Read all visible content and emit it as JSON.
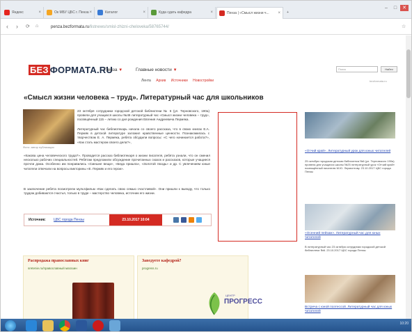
{
  "browser": {
    "tabs": [
      {
        "label": "Яндекс",
        "color": "#e52620"
      },
      {
        "label": "Ок МБУ ЦБС г. Пенза",
        "color": "#f5a623"
      },
      {
        "label": "Каталог",
        "color": "#3a7bd5"
      },
      {
        "label": "Куда сдать кафедра",
        "color": "#5a9a3a"
      },
      {
        "label": "Пенза | «Смысл жизни ч...",
        "color": "#d42a22"
      }
    ],
    "url_host": "penza.bezformata.ru",
    "url_path": "/listnews/smisl-zhizni-cheloveka/58765744/",
    "window_controls": [
      "–",
      "□",
      "✕"
    ]
  },
  "site": {
    "logo_red": "БЕЗ",
    "logo_dark": "ФОРМАТА.RU",
    "city": "Пенза",
    "main_news": "Главные новости",
    "subnav": [
      "Лента",
      "Архив",
      "Источники",
      "Новостройки"
    ],
    "search_placeholder": "Поиск",
    "search_button": "Найти",
    "small_right": "bezformata.ru"
  },
  "article": {
    "title": "«Смысл жизни человека – труд». Литературный час для школьников",
    "photo_caption": "Фото: автор публикации",
    "p1": "23 октября сотрудники городской детской библиотеки № 6 (ул. Терновского, 190а) провели для учащихся школы №46 литературный час «Смысл жизни человека – труд», посвящённый 115 – летию со дня рождения Евгения Андреевича Пермяка.",
    "p2": "Литературный час библиотекарь начала со своего рассказа, что в своих книгах Е.А. Пермяк в детской литературе заложил нравственные ценности. Познакомилась с творчеством Е. А. Пермяка, ребята обсудили вопросы: «С чего начинается работа?», «Как стать мастером своего дела?»,",
    "p3": "«Какова цена человеческого труда?». Проводится рассказ библиотекаря о жизни писателя, ребята узнали, что он сменил несколько рабочих специальностей. Ребятам предложили обсуждение прочитанных сказок и рассказов, которые учащиеся прочли дома. Особенно им понравились «Смешне вещи», «Беда пришла», «Золотой гвоздь» и др. С увлечением юные читатели отвечали на вопросы викторины «Е. Пермяк и его герои».",
    "p4": "В заключение ребята посмотрели мультфильм «Как сделать свою семью счастливой». Они пришли к выводу, что только трудом добиваются счастья, только в труде – мастерство человека, источник его жизни.",
    "source_label": "Источник:",
    "source_link": "ЦБС города Пензы",
    "source_date": "23.10.2017 10:04"
  },
  "promos": [
    {
      "title": "Распродажа православных книг",
      "link": "sretenie.ru/православный магазин",
      "kind": "books"
    },
    {
      "title": "Заведуете кафедрой?",
      "link": "progress.ru",
      "logo_text": "ПРОГРЕСС",
      "logo_small": "ЦЕНТР"
    }
  ],
  "sidebar": [
    {
      "link": "«Отчий край». Литературный урок для юных читателей",
      "text": "25 октября городская детская библиотека №6 (ул. Терновского 190а) провела для учащихся школы №25 литературный урок «Отчий край» посвящённый писателю М.Ю. Лермонтову. 23.10.2017 ЦБС города Пензы"
    },
    {
      "link": "«Осенний пейзаж». Литературный час для юных читателей",
      "text": "В литературный час 23 октября сотрудники городской детской библиотеки №6. 23.10.2017 ЦБС города Пензы"
    },
    {
      "link": "Встреча с юной поэтессой. Литературный час для юных читателей",
      "text": ""
    }
  ],
  "taskbar": {
    "tray_time": "10:20",
    "icons": [
      "start",
      "ie",
      "explorer",
      "chrome",
      "word",
      "opera",
      "paint"
    ]
  }
}
